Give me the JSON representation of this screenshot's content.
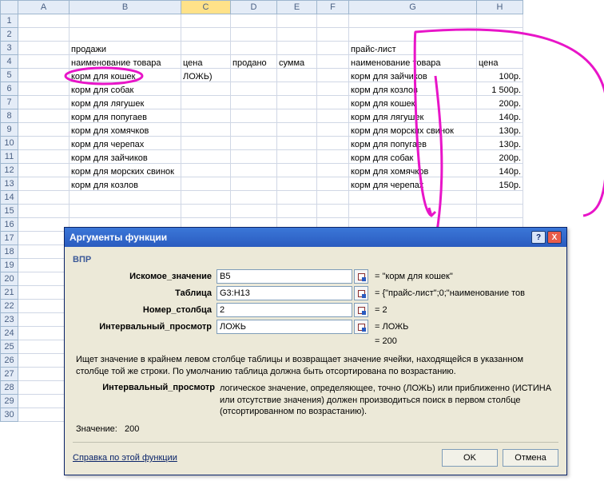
{
  "columns": [
    "A",
    "B",
    "C",
    "D",
    "E",
    "F",
    "G",
    "H"
  ],
  "rows": 30,
  "leftTable": {
    "title": "продажи",
    "headers": {
      "name": "наименование товара",
      "price": "цена",
      "sold": "продано",
      "sum": "сумма"
    },
    "c5": "ЛОЖЬ)",
    "items": [
      "корм для кошек",
      "корм для собак",
      "корм для лягушек",
      "корм для попугаев",
      "корм для хомячков",
      "корм для черепах",
      "корм для зайчиков",
      "корм для морских свинок",
      "корм для козлов"
    ]
  },
  "rightTable": {
    "title": "прайс-лист",
    "headers": {
      "name": "наименование товара",
      "price": "цена"
    },
    "rows": [
      {
        "name": "корм для зайчиков",
        "price": "100р."
      },
      {
        "name": "корм для козлов",
        "price": "1 500р."
      },
      {
        "name": "корм для кошек",
        "price": "200р."
      },
      {
        "name": "корм для лягушек",
        "price": "140р."
      },
      {
        "name": "корм для морских свинок",
        "price": "130р."
      },
      {
        "name": "корм для попугаев",
        "price": "130р."
      },
      {
        "name": "корм для собак",
        "price": "200р."
      },
      {
        "name": "корм для хомячков",
        "price": "140р."
      },
      {
        "name": "корм для черепах",
        "price": "150р."
      }
    ]
  },
  "dialog": {
    "title": "Аргументы функции",
    "fname": "ВПР",
    "args": {
      "a1": {
        "label": "Искомое_значение",
        "value": "B5",
        "eval": "= \"корм для кошек\""
      },
      "a2": {
        "label": "Таблица",
        "value": "G3:H13",
        "eval": "= {\"прайс-лист\";0;\"наименование тов"
      },
      "a3": {
        "label": "Номер_столбца",
        "value": "2",
        "eval": "= 2"
      },
      "a4": {
        "label": "Интервальный_просмотр",
        "value": "ЛОЖЬ",
        "eval": "= ЛОЖЬ"
      }
    },
    "overall": "= 200",
    "desc": "Ищет значение в крайнем левом столбце таблицы и возвращает значение ячейки, находящейся в указанном столбце той же строки. По умолчанию таблица должна быть отсортирована по возрастанию.",
    "argdesc_label": "Интервальный_просмотр",
    "argdesc_text": "логическое значение, определяющее, точно (ЛОЖЬ) или приближенно (ИСТИНА или отсутствие значения) должен производиться поиск в первом столбце (отсортированном по возрастанию).",
    "result_label": "Значение:",
    "result_value": "200",
    "help": "Справка по этой функции",
    "ok": "OK",
    "cancel": "Отмена"
  }
}
